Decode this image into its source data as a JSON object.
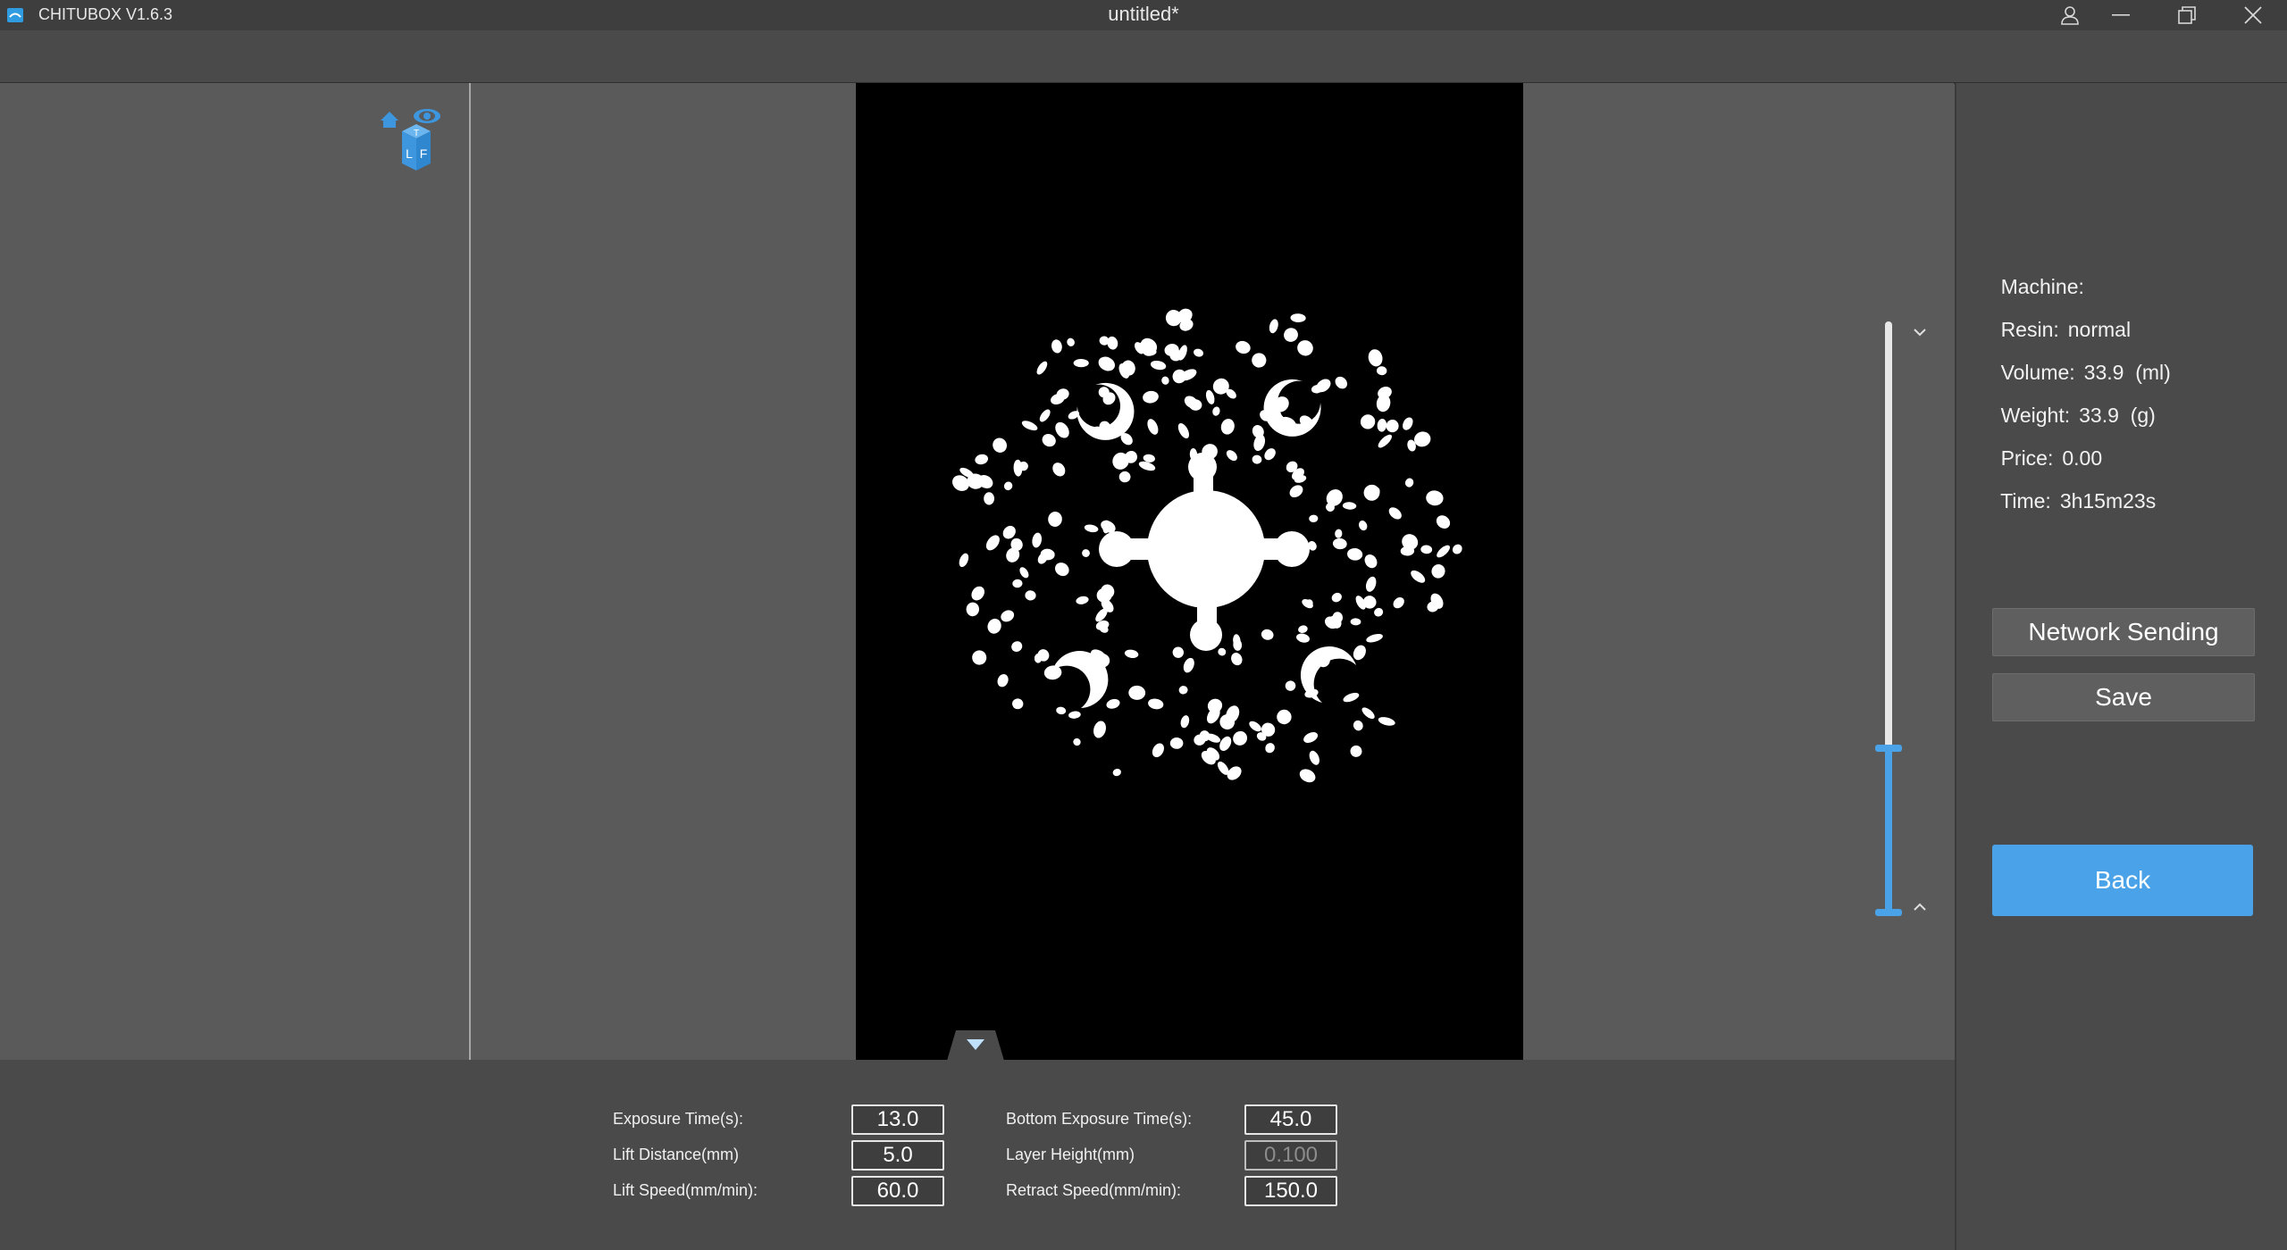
{
  "titlebar": {
    "app_name": "CHITUBOX V1.6.3",
    "doc_title": "untitled*",
    "icons": [
      "user-icon",
      "minimize-icon",
      "restore-icon",
      "close-icon"
    ]
  },
  "view_cube": {
    "icon": "view-cube-icon",
    "faces": [
      "T",
      "L",
      "F"
    ]
  },
  "layer_slider": {
    "position_fraction": 0.28
  },
  "info": {
    "machine": {
      "label": "Machine:",
      "value": ""
    },
    "resin": {
      "label": "Resin:",
      "value": "normal"
    },
    "volume": {
      "label": "Volume:",
      "value": "33.9  (ml)"
    },
    "weight": {
      "label": "Weight:",
      "value": "33.9  (g)"
    },
    "price": {
      "label": "Price:",
      "value": "0.00"
    },
    "time": {
      "label": "Time:",
      "value": "3h15m23s"
    }
  },
  "buttons": {
    "network_sending": "Network Sending",
    "save": "Save",
    "back": "Back"
  },
  "settings": {
    "exposure_time": {
      "label": "Exposure Time(s):",
      "value": "13.0"
    },
    "lift_distance": {
      "label": "Lift Distance(mm)",
      "value": "5.0"
    },
    "lift_speed": {
      "label": "Lift Speed(mm/min):",
      "value": "60.0"
    },
    "bottom_exposure_time": {
      "label": "Bottom Exposure Time(s):",
      "value": "45.0"
    },
    "layer_height": {
      "label": "Layer Height(mm)",
      "value": "0.100"
    },
    "retract_speed": {
      "label": "Retract Speed(mm/min):",
      "value": "150.0"
    }
  },
  "colors": {
    "accent": "#4aa3e8",
    "panel": "#4a4a4a",
    "workspace": "#5a5a5a",
    "canvas": "#000000",
    "slice": "#ffffff"
  }
}
